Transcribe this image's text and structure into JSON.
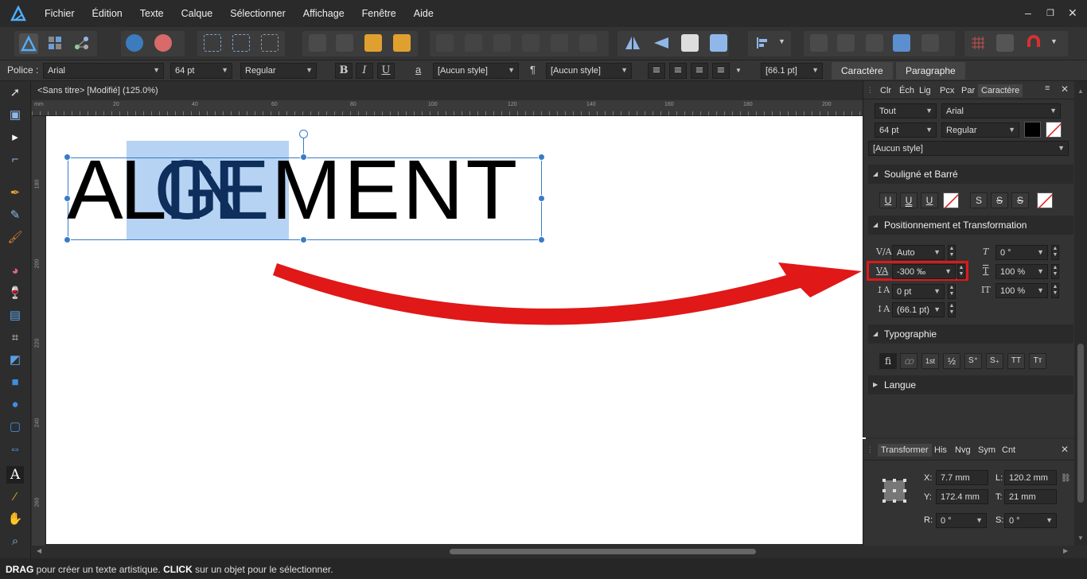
{
  "menu": [
    "Fichier",
    "Édition",
    "Texte",
    "Calque",
    "Sélectionner",
    "Affichage",
    "Fenêtre",
    "Aide"
  ],
  "window_controls": [
    "–",
    "❐",
    "✕"
  ],
  "context": {
    "font_label": "Police :",
    "font_family": "Arial",
    "font_size": "64 pt",
    "font_style": "Regular",
    "bold": "B",
    "italic": "I",
    "underline": "U",
    "char_style": "[Aucun style]",
    "para_style": "[Aucun style]",
    "leading": "[66.1 pt]",
    "tab_character": "Caractère",
    "tab_paragraph": "Paragraphe"
  },
  "document": {
    "title": "<Sans titre> [Modifié] (125.0%)",
    "ruler_unit": "mm",
    "ruler_top_ticks": [
      "20",
      "40",
      "60",
      "80",
      "100",
      "120",
      "140",
      "160",
      "180",
      "200"
    ],
    "ruler_left_ticks": [
      "180",
      "200",
      "220",
      "240",
      "260"
    ],
    "text": "ALIGNEMENT",
    "text_pre": "AL",
    "text_selected": "IGNE",
    "text_post": "MENT"
  },
  "panel_char": {
    "tabs": [
      "Clr",
      "Éch",
      "Lig",
      "Pcx",
      "Par",
      "Caractère"
    ],
    "scope": "Tout",
    "font": "Arial",
    "size": "64 pt",
    "style": "Regular",
    "char_style": "[Aucun style]",
    "sec_underline": "Souligné et Barré",
    "sec_position": "Positionnement et Transformation",
    "kerning": "Auto",
    "tracking": "-300 ‰",
    "baseline": "0 pt",
    "leading": "(66.1 pt)",
    "shear": "0 °",
    "vscale": "100 %",
    "hscale": "100 %",
    "sec_typo": "Typographie",
    "typo_buttons": [
      "fi",
      "ꝏ",
      "1st",
      "½",
      "S⁺",
      "S₊",
      "TT",
      "Tт"
    ],
    "sec_lang": "Langue",
    "accent_red": "#e01818"
  },
  "panel_transform": {
    "tabs": [
      "Transformer",
      "His",
      "Nvg",
      "Sym",
      "Cnt"
    ],
    "x_label": "X:",
    "x": "7.7 mm",
    "y_label": "Y:",
    "y": "172.4 mm",
    "w_label": "L:",
    "w": "120.2 mm",
    "h_label": "T:",
    "h": "21 mm",
    "r_label": "R:",
    "r": "0 °",
    "s_label": "S:",
    "s": "0 °"
  },
  "status": {
    "drag": "DRAG",
    "drag_text": " pour créer un texte artistique. ",
    "click": "CLICK",
    "click_text": " sur un objet pour le sélectionner."
  }
}
